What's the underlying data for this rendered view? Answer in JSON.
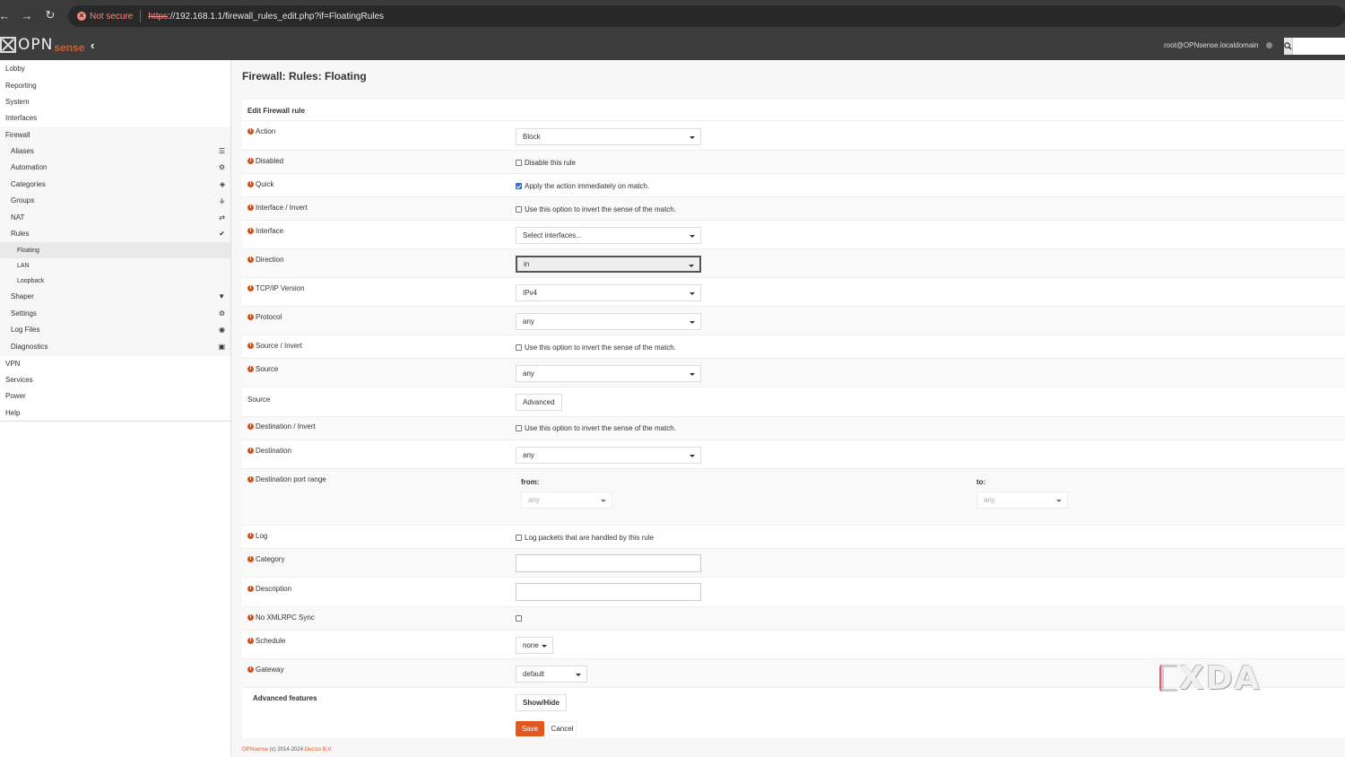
{
  "browser": {
    "back": "←",
    "forward": "→",
    "reload": "↻",
    "security_label": "Not secure",
    "url_protocol": "https",
    "url_rest": "://192.168.1.1/firewall_rules_edit.php?if=FloatingRules"
  },
  "header": {
    "logo_opn": "OPN",
    "logo_sense": "sense",
    "user": "root@OPNsense.localdomain",
    "search_placeholder": ""
  },
  "sidebar": {
    "items": [
      {
        "label": "Lobby"
      },
      {
        "label": "Reporting"
      },
      {
        "label": "System"
      },
      {
        "label": "Interfaces"
      },
      {
        "label": "Firewall"
      },
      {
        "label": "Aliases"
      },
      {
        "label": "Automation"
      },
      {
        "label": "Categories"
      },
      {
        "label": "Groups"
      },
      {
        "label": "NAT"
      },
      {
        "label": "Rules"
      },
      {
        "label": "Floating"
      },
      {
        "label": "LAN"
      },
      {
        "label": "Loopback"
      },
      {
        "label": "Shaper"
      },
      {
        "label": "Settings"
      },
      {
        "label": "Log Files"
      },
      {
        "label": "Diagnostics"
      },
      {
        "label": "VPN"
      },
      {
        "label": "Services"
      },
      {
        "label": "Power"
      },
      {
        "label": "Help"
      }
    ]
  },
  "page": {
    "title": "Firewall: Rules: Floating",
    "panel_title": "Edit Firewall rule"
  },
  "form": {
    "action": {
      "label": "Action",
      "value": "Block"
    },
    "disabled": {
      "label": "Disabled",
      "text": "Disable this rule",
      "checked": false
    },
    "quick": {
      "label": "Quick",
      "text": "Apply the action immediately on match.",
      "checked": true
    },
    "interface_invert": {
      "label": "Interface / Invert",
      "text": "Use this option to invert the sense of the match."
    },
    "interface": {
      "label": "Interface",
      "value": "Select interfaces..."
    },
    "direction": {
      "label": "Direction",
      "value": "in"
    },
    "ipversion": {
      "label": "TCP/IP Version",
      "value": "IPv4"
    },
    "protocol": {
      "label": "Protocol",
      "value": "any"
    },
    "source_invert": {
      "label": "Source / Invert",
      "text": "Use this option to invert the sense of the match."
    },
    "source": {
      "label": "Source",
      "value": "any"
    },
    "source_adv": {
      "label": "Source",
      "button": "Advanced"
    },
    "dest_invert": {
      "label": "Destination / Invert",
      "text": "Use this option to invert the sense of the match."
    },
    "destination": {
      "label": "Destination",
      "value": "any"
    },
    "dest_port": {
      "label": "Destination port range",
      "from_label": "from:",
      "to_label": "to:",
      "from_value": "any",
      "to_value": "any"
    },
    "log": {
      "label": "Log",
      "text": "Log packets that are handled by this rule"
    },
    "category": {
      "label": "Category",
      "value": ""
    },
    "description": {
      "label": "Description",
      "value": ""
    },
    "xmlrpc": {
      "label": "No XMLRPC Sync"
    },
    "schedule": {
      "label": "Schedule",
      "value": "none"
    },
    "gateway": {
      "label": "Gateway",
      "value": "default"
    },
    "advanced": {
      "label": "Advanced features",
      "button": "Show/Hide"
    },
    "save": "Save",
    "cancel": "Cancel"
  },
  "footer": {
    "brand": "OPNsense",
    "copyright": " (c) 2014-2024 ",
    "company": "Deciso B.V."
  },
  "watermark": "XDA",
  "colors": {
    "accent": "#e2571e",
    "header": "#3d3d3d"
  }
}
